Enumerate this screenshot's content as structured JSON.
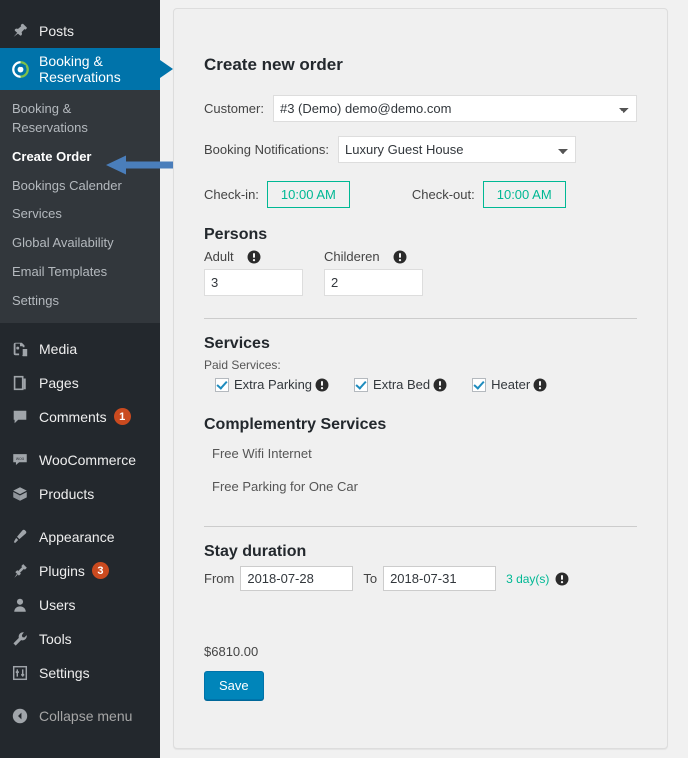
{
  "sidebar": {
    "top_items": [
      {
        "label": "Posts",
        "icon": "pin-icon",
        "badge": null
      }
    ],
    "active_item": {
      "label": "Booking &\nReservations",
      "icon": "booking-reservations-icon"
    },
    "submenu": [
      {
        "label": "Booking &\nReservations",
        "current": false
      },
      {
        "label": "Create Order",
        "current": true
      },
      {
        "label": "Bookings Calender",
        "current": false
      },
      {
        "label": "Services",
        "current": false
      },
      {
        "label": "Global Availability",
        "current": false
      },
      {
        "label": "Email Templates",
        "current": false
      },
      {
        "label": "Settings",
        "current": false
      }
    ],
    "group_b": [
      {
        "label": "Media",
        "icon": "media-icon",
        "badge": null
      },
      {
        "label": "Pages",
        "icon": "pages-icon",
        "badge": null
      },
      {
        "label": "Comments",
        "icon": "comments-icon",
        "badge": "1"
      }
    ],
    "group_c": [
      {
        "label": "WooCommerce",
        "icon": "woocommerce-icon",
        "badge": null
      },
      {
        "label": "Products",
        "icon": "products-icon",
        "badge": null
      }
    ],
    "group_d": [
      {
        "label": "Appearance",
        "icon": "appearance-icon",
        "badge": null
      },
      {
        "label": "Plugins",
        "icon": "plugins-icon",
        "badge": "3"
      },
      {
        "label": "Users",
        "icon": "users-icon",
        "badge": null
      },
      {
        "label": "Tools",
        "icon": "tools-icon",
        "badge": null
      },
      {
        "label": "Settings",
        "icon": "settings-icon",
        "badge": null
      }
    ],
    "collapse": {
      "label": "Collapse menu",
      "icon": "collapse-arrow-icon"
    }
  },
  "main": {
    "title": "Create new order",
    "customer": {
      "label": "Customer:",
      "value": "#3 (Demo) demo@demo.com"
    },
    "notifications": {
      "label": "Booking Notifications:",
      "value": "Luxury Guest House"
    },
    "checkin": {
      "label": "Check-in:",
      "value": "10:00 AM"
    },
    "checkout": {
      "label": "Check-out:",
      "value": "10:00 AM"
    },
    "persons": {
      "heading": "Persons",
      "adult_label": "Adult",
      "adult_value": "3",
      "children_label": "Childeren",
      "children_value": "2"
    },
    "services": {
      "heading": "Services",
      "paid_label": "Paid Services:",
      "items": [
        {
          "label": "Extra Parking",
          "checked": true
        },
        {
          "label": "Extra Bed",
          "checked": true
        },
        {
          "label": "Heater",
          "checked": true
        }
      ]
    },
    "complementary": {
      "heading": "Complementry Services",
      "items": [
        "Free Wifi Internet",
        "Free Parking for One Car"
      ]
    },
    "stay": {
      "heading": "Stay duration",
      "from_label": "From",
      "from_value": "2018-07-28",
      "to_label": "To",
      "to_value": "2018-07-31",
      "duration_note": "3 day(s)"
    },
    "total_price": "$6810.00",
    "save_label": "Save"
  },
  "colors": {
    "wp_blue": "#0073aa",
    "sidebar_bg": "#23282d",
    "submenu_bg": "#32373c",
    "accent_green": "#00b894",
    "badge_red": "#ca4a1f",
    "annotation_arrow": "#4a7ebb"
  }
}
